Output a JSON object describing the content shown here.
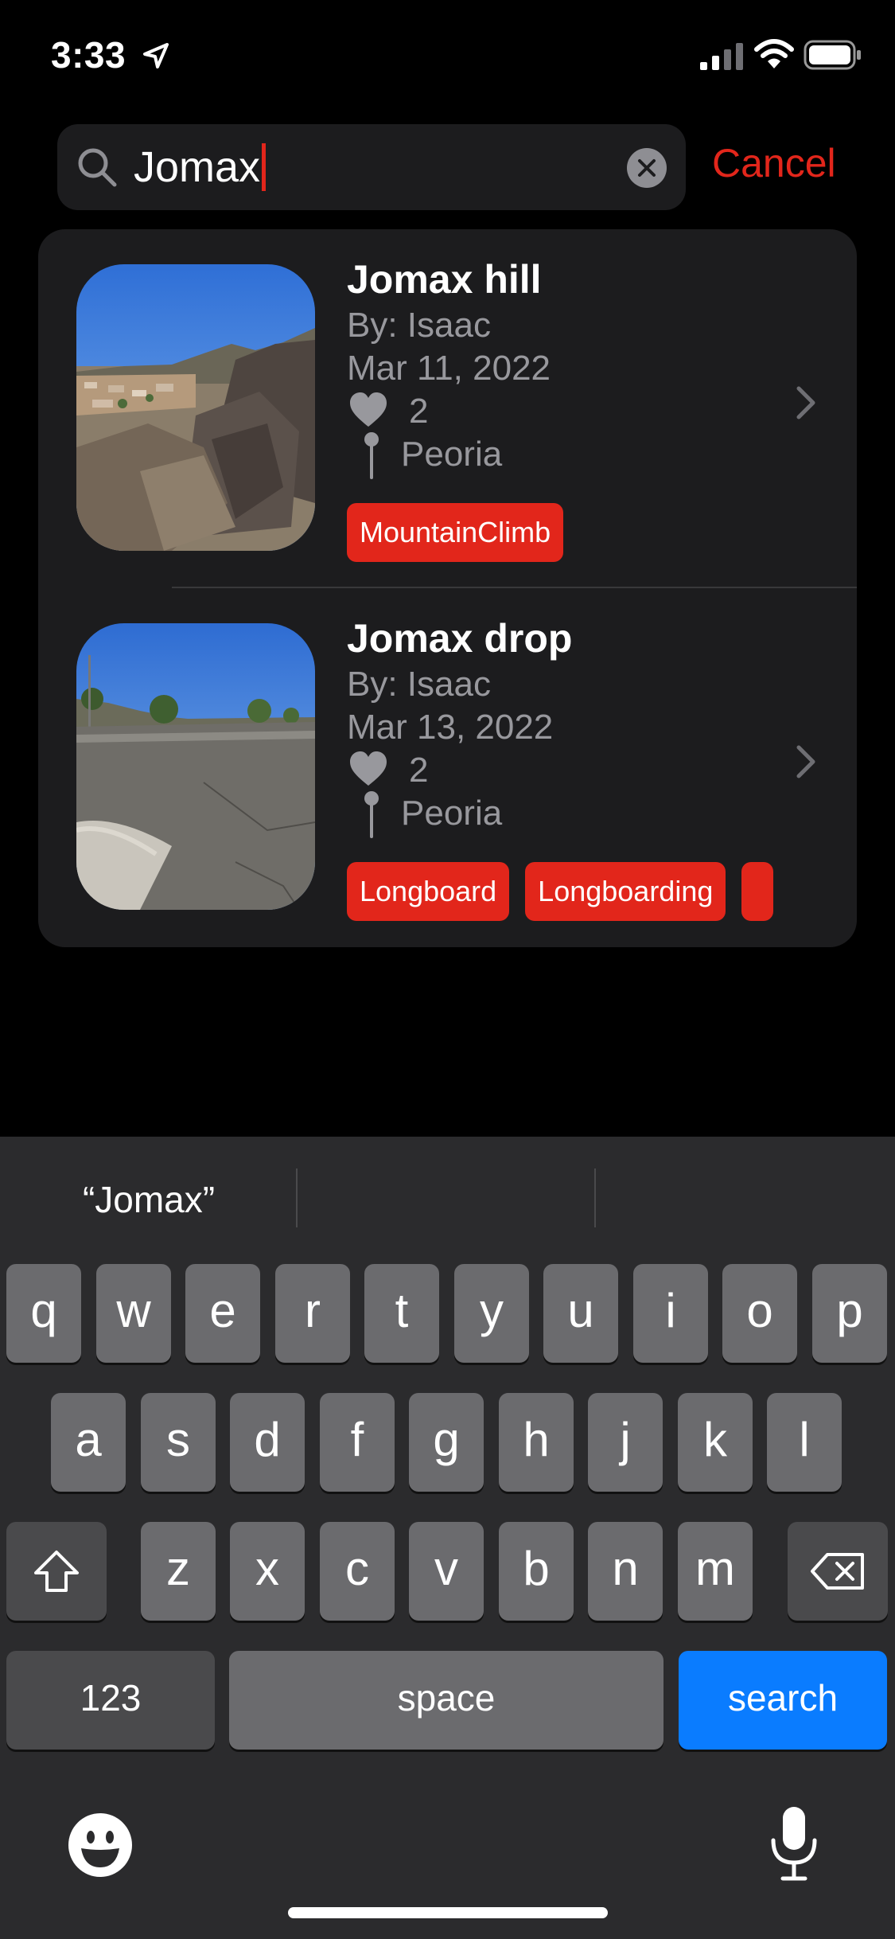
{
  "status_bar": {
    "time": "3:33",
    "location_icon": "location-arrow-icon",
    "signal_icon": "cellular-signal-icon",
    "wifi_icon": "wifi-icon",
    "battery_icon": "battery-icon"
  },
  "search": {
    "query": "Jomax",
    "clear_icon": "clear-circle-icon",
    "cancel_label": "Cancel"
  },
  "results": [
    {
      "title": "Jomax hill",
      "author": "By: Isaac",
      "date": "Mar 11, 2022",
      "likes": "2",
      "location": "Peoria",
      "tags": [
        "MountainClimb"
      ],
      "image": "mountain-photo"
    },
    {
      "title": "Jomax drop",
      "author": "By: Isaac",
      "date": "Mar 13, 2022",
      "likes": "2",
      "location": "Peoria",
      "tags": [
        "Longboard",
        "Longboarding",
        ""
      ],
      "image": "road-photo"
    }
  ],
  "keyboard": {
    "suggestions": [
      "“Jomax”",
      "",
      ""
    ],
    "row1": [
      "q",
      "w",
      "e",
      "r",
      "t",
      "y",
      "u",
      "i",
      "o",
      "p"
    ],
    "row2": [
      "a",
      "s",
      "d",
      "f",
      "g",
      "h",
      "j",
      "k",
      "l"
    ],
    "row3": [
      "z",
      "x",
      "c",
      "v",
      "b",
      "n",
      "m"
    ],
    "numbers_label": "123",
    "space_label": "space",
    "search_label": "search"
  },
  "colors": {
    "accent": "#e2261b",
    "search_key": "#0a7cff",
    "card": "#1c1c1e"
  }
}
